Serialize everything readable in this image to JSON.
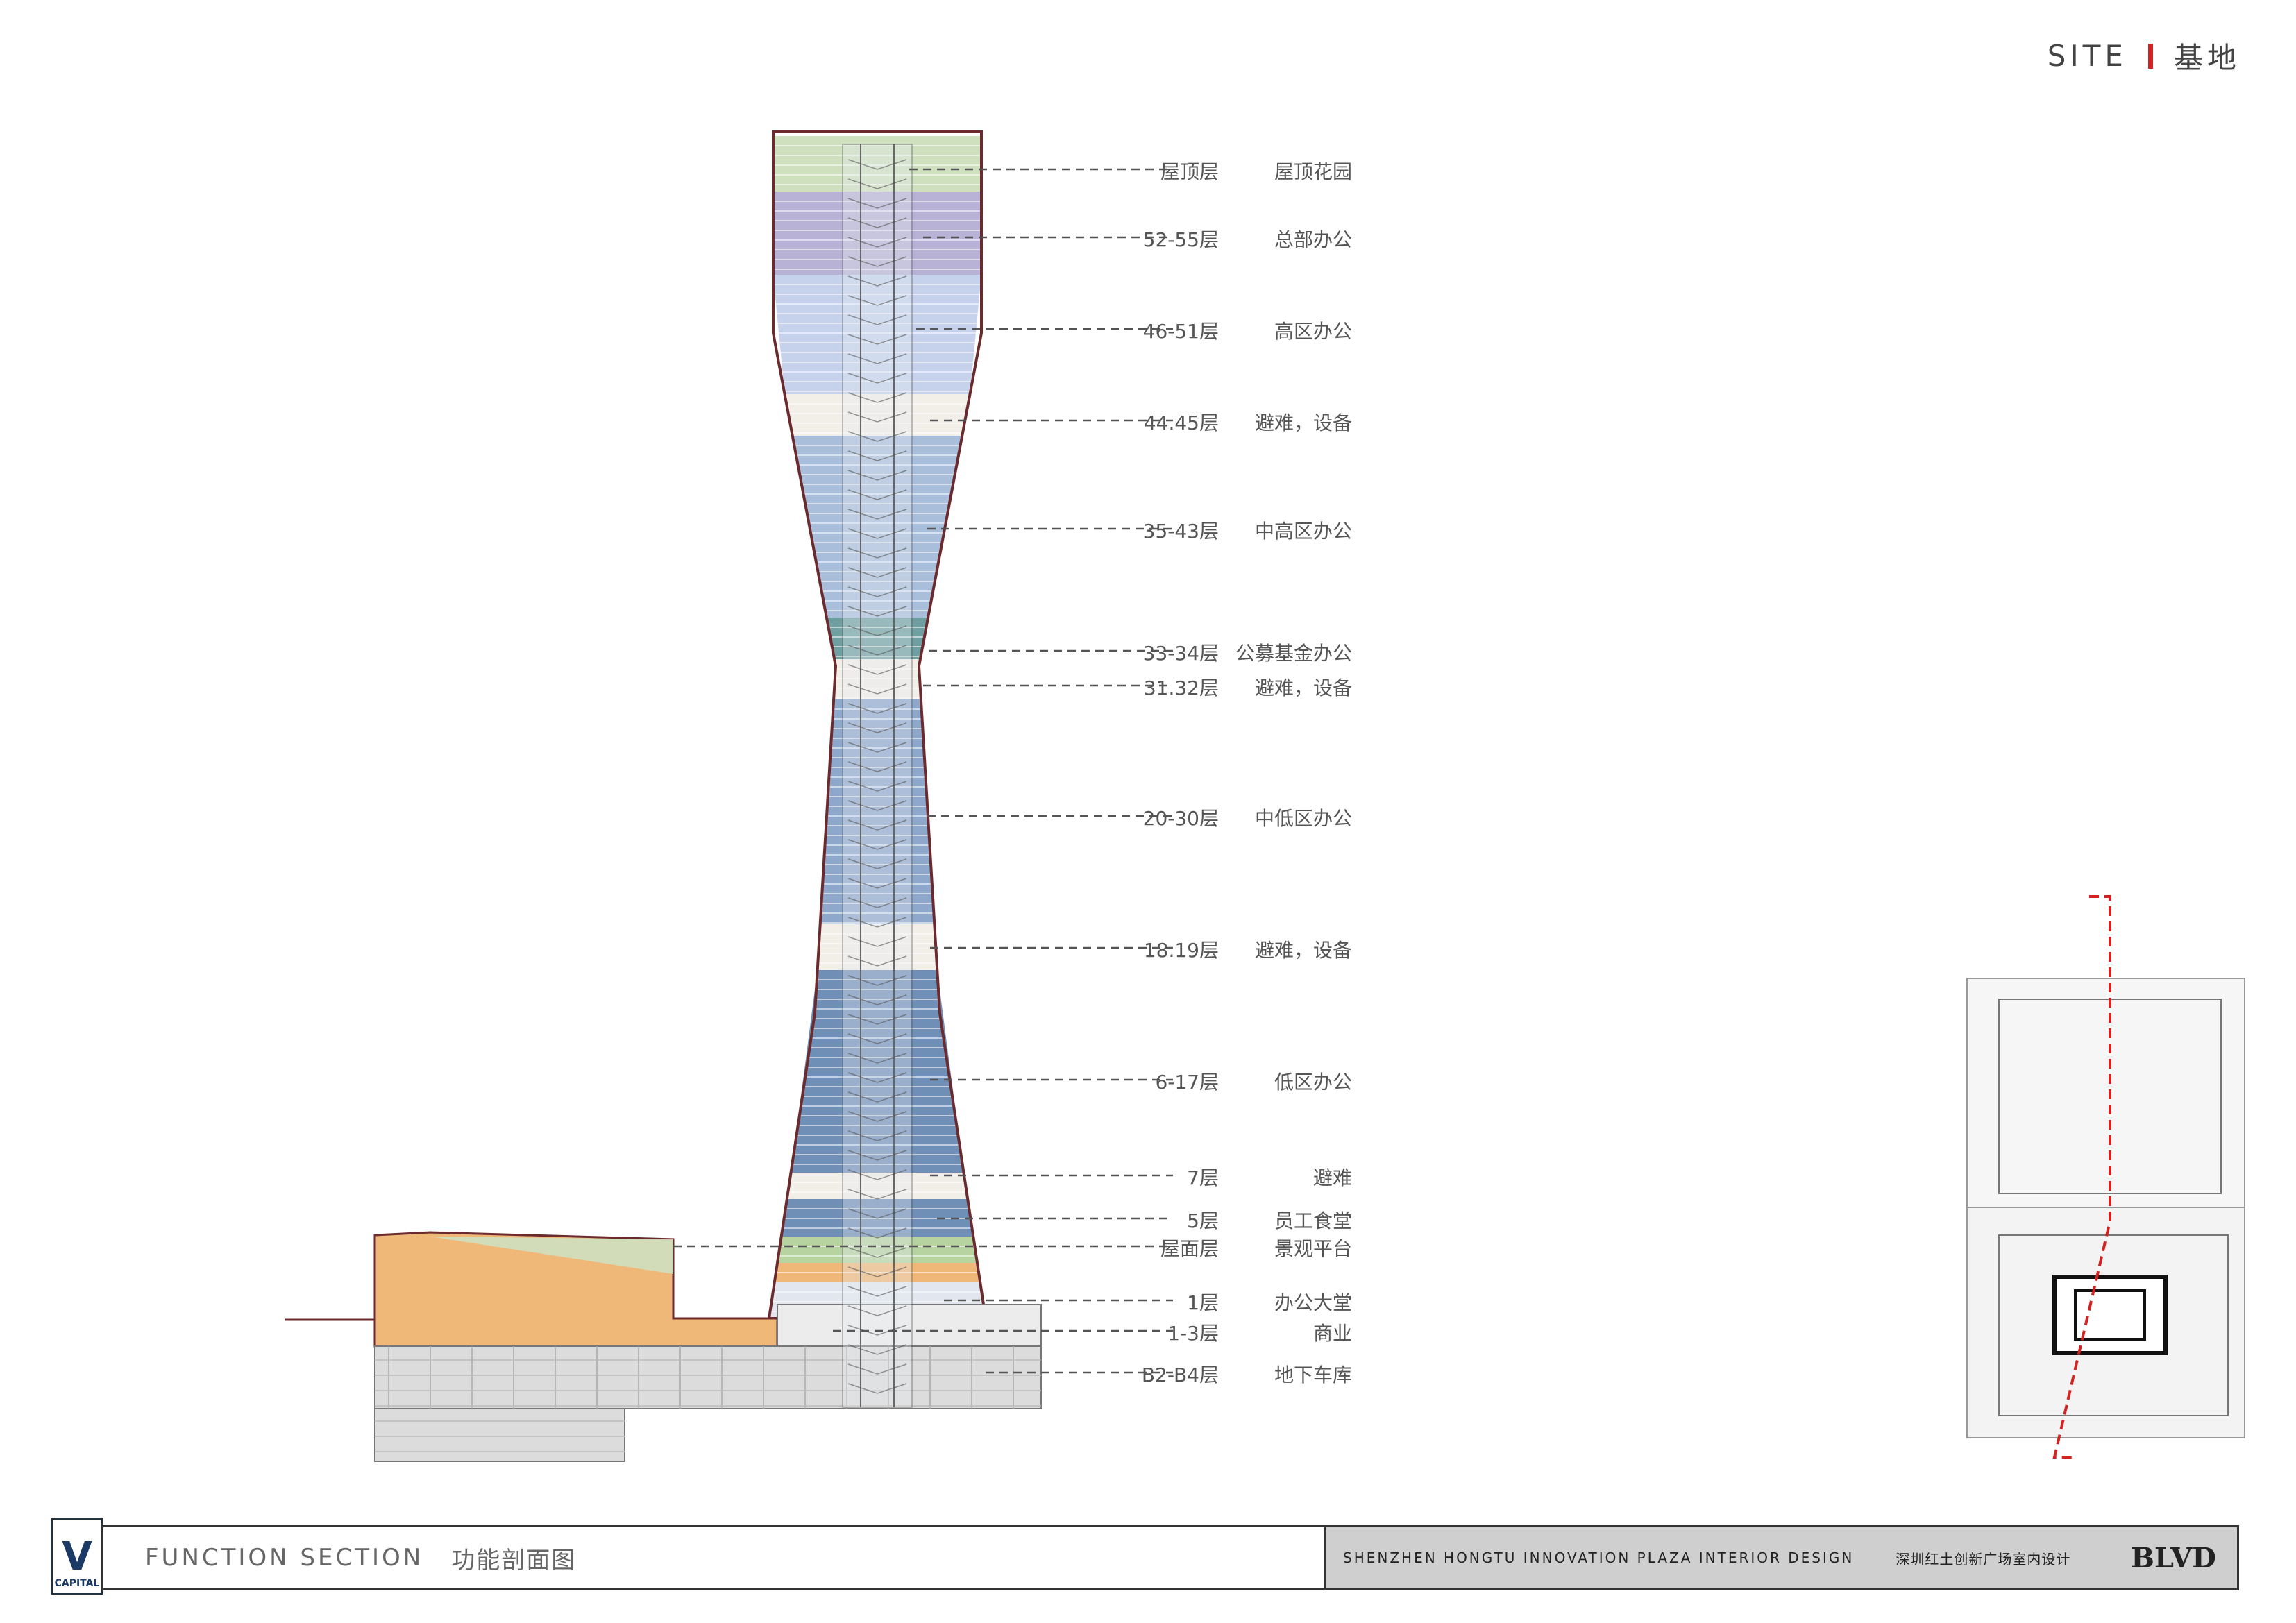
{
  "header": {
    "site_en": "SITE",
    "site_cn": "基地"
  },
  "section_labels": [
    {
      "level": "屋顶层",
      "function": "屋顶花园"
    },
    {
      "level": "52-55层",
      "function": "总部办公"
    },
    {
      "level": "46-51层",
      "function": "高区办公"
    },
    {
      "level": "44.45层",
      "function": "避难，设备"
    },
    {
      "level": "35-43层",
      "function": "中高区办公"
    },
    {
      "level": "33-34层",
      "function": "公募基金办公"
    },
    {
      "level": "31.32层",
      "function": "避难，设备"
    },
    {
      "level": "20-30层",
      "function": "中低区办公"
    },
    {
      "level": "18.19层",
      "function": "避难，设备"
    },
    {
      "level": "6-17层",
      "function": "低区办公"
    },
    {
      "level": "7层",
      "function": "避难"
    },
    {
      "level": "5层",
      "function": "员工食堂"
    },
    {
      "level": "屋面层",
      "function": "景观平台"
    },
    {
      "level": "1层",
      "function": "办公大堂"
    },
    {
      "level": "1-3层",
      "function": "商业"
    },
    {
      "level": "B2-B4层",
      "function": "地下车库"
    }
  ],
  "zone_colors": {
    "roof_garden": "#cfe0bf",
    "hq_office": "#b7b2d6",
    "high_office": "#c6d2ec",
    "refuge": "#f2efe9",
    "mid_high_office": "#a9bedb",
    "fund_office": "#6f9fa0",
    "mid_low_office": "#8ea8cb",
    "low_office": "#6f8fb6",
    "canteen": "#b7d3a0",
    "lobby": "#e2e6ee",
    "retail": "#f0b878",
    "basement": "#dcdcdc",
    "outline": "#6b2a2e",
    "leader": "#555555",
    "cut_line": "#d32222"
  },
  "footer": {
    "title_en": "FUNCTION SECTION",
    "title_cn": "功能剖面图",
    "project_en": "SHENZHEN HONGTU INNOVATION PLAZA INTERIOR DESIGN",
    "project_cn": "深圳红土创新广场室内设计",
    "brand": "BLVD",
    "logo_letter": "V",
    "logo_text": "CAPITAL"
  }
}
